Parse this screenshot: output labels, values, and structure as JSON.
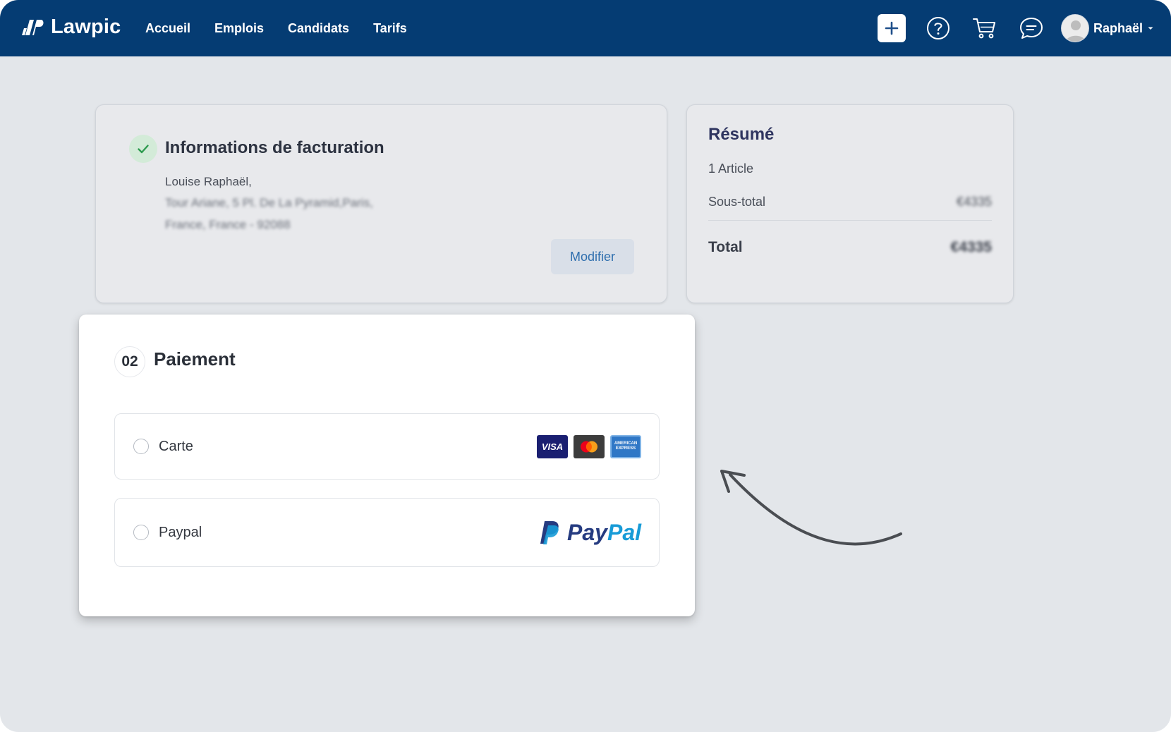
{
  "app": {
    "brand": "Lawpic"
  },
  "nav": {
    "links": [
      "Accueil",
      "Emplois",
      "Candidats",
      "Tarifs"
    ],
    "user_name": "Raphaël",
    "icons": [
      "plus-icon",
      "help-icon",
      "cart-icon",
      "chat-icon",
      "chevron-down-icon"
    ]
  },
  "billing": {
    "title": "Informations de facturation",
    "name_line": "Louise Raphaël,",
    "address_line1": "Tour Ariane, 5 Pl. De La Pyramid,Paris,",
    "address_line2": "France, France - 92088",
    "modify_label": "Modifier",
    "status_icon": "check-icon"
  },
  "summary": {
    "title": "Résumé",
    "count_number": "1",
    "count_label": "Article",
    "subtotal_label": "Sous-total",
    "subtotal_value": "€4335",
    "total_label": "Total",
    "total_value": "€4335"
  },
  "payment": {
    "step": "02",
    "title": "Paiement",
    "options": [
      {
        "label": "Carte",
        "selected": false
      },
      {
        "label": "Paypal",
        "selected": false
      }
    ],
    "card_brands": {
      "visa": "VISA",
      "amex_line1": "AMERICAN",
      "amex_line2": "EXPRESS"
    },
    "paypal_logo_pay": "Pay",
    "paypal_logo_pal": "Pal"
  },
  "colors": {
    "nav_bg": "#053c73",
    "page_bg": "#e3e6ea",
    "accent_link": "#2f6fae",
    "success": "#2e9b4f",
    "paypal_dark": "#253b80",
    "paypal_light": "#179bd7"
  }
}
